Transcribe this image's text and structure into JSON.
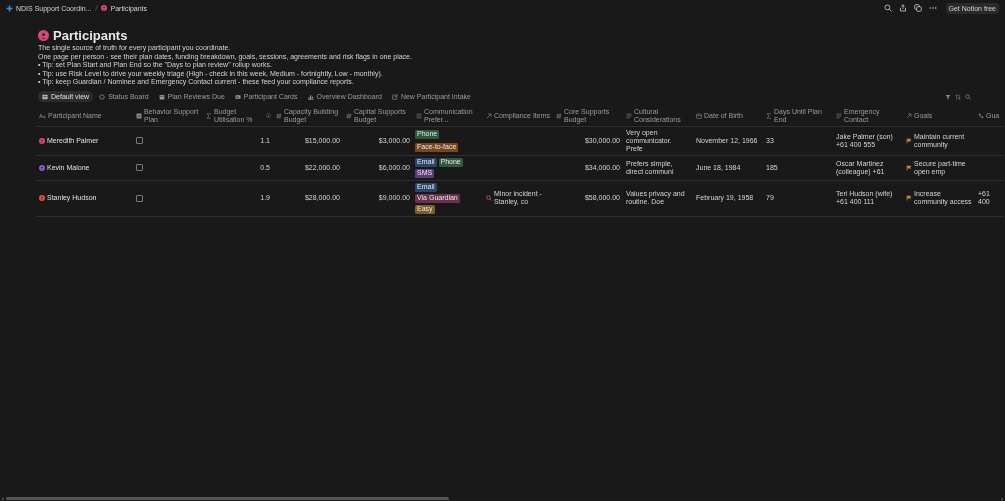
{
  "breadcrumb": [
    {
      "text": "NDIS Support Coordin...",
      "kind": "workspace"
    },
    {
      "text": "Participants",
      "kind": "page"
    }
  ],
  "topbar": {
    "cta": "Get Notion free"
  },
  "page": {
    "title": "Participants",
    "description": [
      "The single source of truth for every participant you coordinate.",
      "One page per person - see their plan dates, funding breakdown, goals, sessions, agreements and risk flags in one place.",
      "• Tip: set Plan Start and Plan End so the \"Days to plan review\" rollup works.",
      "• Tip: use Risk Level to drive your weekly triage (High - check in this week, Medium - fortnightly, Low - monthly).",
      "• Tip: keep Guardian / Nominee and Emergency Contact current - these feed your compliance reports."
    ]
  },
  "views": [
    {
      "label": "Default view",
      "kind": "table",
      "selected": true
    },
    {
      "label": "Status Board",
      "kind": "board",
      "selected": false
    },
    {
      "label": "Plan Reviews Due",
      "kind": "calendar",
      "selected": false
    },
    {
      "label": "Participant Cards",
      "kind": "gallery",
      "selected": false
    },
    {
      "label": "Overview Dashboard",
      "kind": "chart",
      "selected": false
    },
    {
      "label": "New Participant Intake",
      "kind": "form",
      "selected": false
    }
  ],
  "table": {
    "columns": [
      {
        "name": "Participant Name",
        "kind": "title"
      },
      {
        "name": "Behavior Support Plan",
        "kind": "checkbox"
      },
      {
        "name": "Budget Utilisation %",
        "kind": "formula"
      },
      {
        "name": "Capacity Building Budget",
        "kind": "number"
      },
      {
        "name": "Capital Supports Budget",
        "kind": "number"
      },
      {
        "name": "Communication Prefer...",
        "kind": "multiselect"
      },
      {
        "name": "Compliance Items",
        "kind": "relation"
      },
      {
        "name": "Core Supports Budget",
        "kind": "number"
      },
      {
        "name": "Cultural Considerations",
        "kind": "text"
      },
      {
        "name": "Date of Birth",
        "kind": "date"
      },
      {
        "name": "Days Until Plan End",
        "kind": "formula"
      },
      {
        "name": "Emergency Contact",
        "kind": "text"
      },
      {
        "name": "Goals",
        "kind": "relation"
      },
      {
        "name": "Gua",
        "kind": "phone"
      }
    ],
    "rows": [
      {
        "name": "Meredith Palmer",
        "color": "#d6487a",
        "behavior_support_plan": false,
        "budget_utilisation": "1.1",
        "capacity_budget": "$15,000.00",
        "capital_budget": "$3,000.00",
        "communication": [
          {
            "text": "Phone",
            "color": "#2d5a3d"
          },
          {
            "text": "Face-to-face",
            "color": "#7a4620"
          }
        ],
        "core_budget": "$30,000.00",
        "cultural": "Very open communicator. Prefe",
        "dob": "November 12, 1966",
        "days": "33",
        "emergency": "Jake Palmer (son) +61 400 555",
        "goals": "Maintain current community"
      },
      {
        "name": "Kevin Malone",
        "color": "#8a5ad0",
        "behavior_support_plan": false,
        "budget_utilisation": "0.5",
        "capacity_budget": "$22,000.00",
        "capital_budget": "$6,000.00",
        "communication": [
          {
            "text": "Email",
            "color": "#28456c"
          },
          {
            "text": "Phone",
            "color": "#2d5a3d"
          },
          {
            "text": "SMS",
            "color": "#5a3d7a"
          }
        ],
        "core_budget": "$34,000.00",
        "cultural": "Prefers simple, direct communi",
        "dob": "June 18, 1984",
        "days": "185",
        "emergency": "Oscar Martinez (colleague) +61",
        "goals": "Secure part-time open emp"
      },
      {
        "name": "Stanley Hudson",
        "color": "#e0503a",
        "behavior_support_plan": false,
        "budget_utilisation": "1.9",
        "capacity_budget": "$28,000.00",
        "capital_budget": "$9,000.00",
        "communication": [
          {
            "text": "Email",
            "color": "#28456c"
          },
          {
            "text": "Via Guardian",
            "color": "#6b2f50"
          },
          {
            "text": "Easy",
            "color": "#7a5e28"
          }
        ],
        "compliance": "Minor incident - Stanley, co",
        "core_budget": "$58,000.00",
        "cultural": "Values privacy and routine. Doe",
        "dob": "February 19, 1958",
        "days": "79",
        "emergency": "Teri Hudson (wife) +61 400 111",
        "goals": "Increase community access",
        "guardian": "+61 400"
      }
    ]
  }
}
